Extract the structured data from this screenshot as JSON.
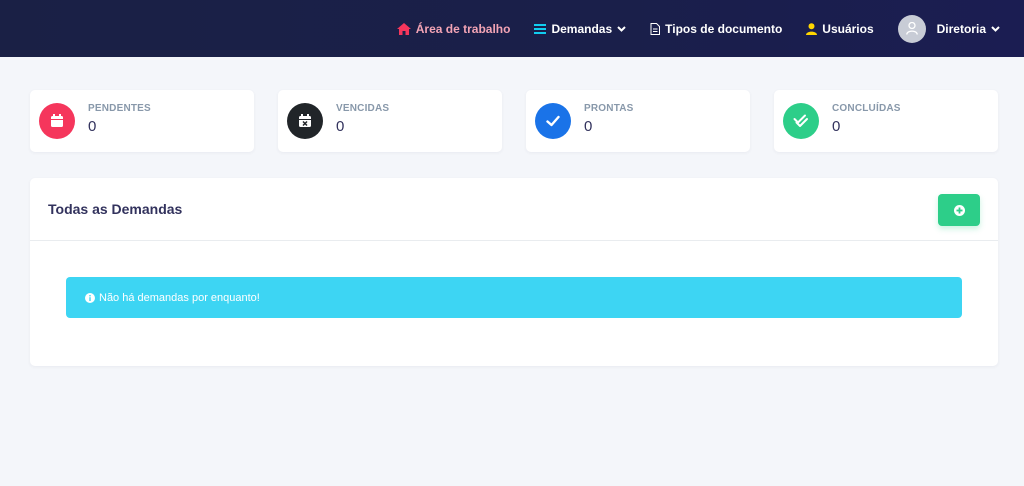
{
  "nav": {
    "home_label": "Área de trabalho",
    "demandas_label": "Demandas",
    "tipos_label": "Tipos de documento",
    "usuarios_label": "Usuários",
    "user_label": "Diretoria"
  },
  "stats": [
    {
      "label": "PENDENTES",
      "value": "0",
      "icon": "calendar-icon",
      "color": "#f5365c"
    },
    {
      "label": "VENCIDAS",
      "value": "0",
      "icon": "calendar-x-icon",
      "color": "#212529"
    },
    {
      "label": "PRONTAS",
      "value": "0",
      "icon": "check-icon",
      "color": "#1a73e8"
    },
    {
      "label": "CONCLUÍDAS",
      "value": "0",
      "icon": "double-check-icon",
      "color": "#2dce89"
    }
  ],
  "main": {
    "title": "Todas as Demandas",
    "empty_message": "Não há demandas por enquanto!"
  },
  "colors": {
    "accent_red": "#f5365c",
    "success": "#2dce89",
    "info": "#3dd5f3",
    "nav_bg": "#1a2045"
  }
}
